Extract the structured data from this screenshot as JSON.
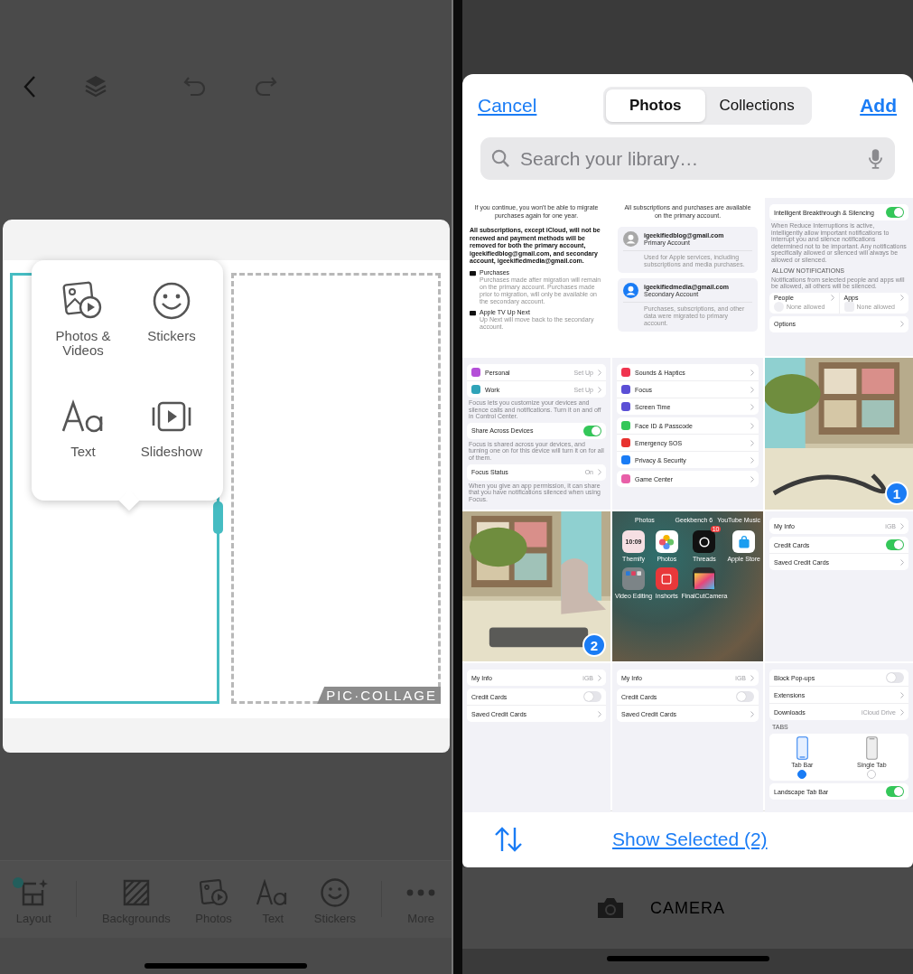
{
  "editor": {
    "popup_menu": {
      "items": [
        {
          "label": "Photos & Videos"
        },
        {
          "label": "Stickers"
        },
        {
          "label": "Text"
        },
        {
          "label": "Slideshow"
        }
      ]
    },
    "canvas": {
      "watermark": "PIC·COLLAGE"
    },
    "bottom_toolbar": {
      "items": [
        {
          "label": "Layout",
          "new_dot": true
        },
        {
          "label": "Backgrounds",
          "new_dot": false
        },
        {
          "label": "Photos",
          "new_dot": false
        },
        {
          "label": "Text",
          "new_dot": false
        },
        {
          "label": "Stickers",
          "new_dot": false
        },
        {
          "label": "More",
          "new_dot": false
        }
      ]
    }
  },
  "picker": {
    "cancel": "Cancel",
    "add": "Add",
    "tabs": [
      {
        "label": "Photos",
        "selected": true
      },
      {
        "label": "Collections",
        "selected": false
      }
    ],
    "search": {
      "placeholder": "Search your library…"
    },
    "grid": {
      "cells": [
        {
          "kind": "document",
          "blocks": [
            {
              "kind": "intro",
              "text": "If you continue, you won't be able to migrate purchases again for one year."
            },
            {
              "kind": "warning",
              "text": "All subscriptions, except iCloud, will not be renewed and payment methods will be removed for both the primary account, igeekifiedblog@gmail.com, and secondary account, igeekifiedmedia@gmail.com."
            },
            {
              "kind": "feature",
              "title": "Purchases",
              "note": "Purchases made after migration will remain on the primary account. Purchases made prior to migration, will only be available on the secondary account."
            },
            {
              "kind": "feature",
              "title": "Apple TV Up Next",
              "note": "Up Next will move back to the secondary account."
            }
          ]
        },
        {
          "kind": "document",
          "blocks": [
            {
              "kind": "intro",
              "text": "All subscriptions and purchases are available on the primary account."
            },
            {
              "kind": "account",
              "email": "igeekifiedblog@gmail.com",
              "role": "Primary Account",
              "note": "Used for Apple services, including subscriptions and media purchases.",
              "color": "#a8a8a8"
            },
            {
              "kind": "account",
              "email": "igeekifiedmedia@gmail.com",
              "role": "Secondary Account",
              "note": "Purchases, subscriptions, and other data were migrated to primary account.",
              "color": "#1a7cf5"
            }
          ]
        },
        {
          "kind": "settings",
          "blocks": [
            {
              "kind": "group",
              "rows": [
                {
                  "kind": "switch",
                  "label": "Intelligent Breakthrough & Silencing",
                  "on": true
                }
              ]
            },
            {
              "kind": "note",
              "text": "When Reduce Interruptions is active, intelligently allow important notifications to interrupt you and silence notifications determined not to be important. Any notifications specifically allowed or silenced will always be allowed or silenced."
            },
            {
              "kind": "section",
              "text": "ALLOW NOTIFICATIONS"
            },
            {
              "kind": "note",
              "text": "Notifications from selected people and apps will be allowed, all others will be silenced."
            },
            {
              "kind": "split",
              "items": [
                {
                  "label": "People",
                  "note": "None allowed"
                },
                {
                  "label": "Apps",
                  "note": "None allowed"
                }
              ]
            },
            {
              "kind": "group",
              "rows": [
                {
                  "kind": "link",
                  "label": "Options"
                }
              ]
            }
          ]
        },
        {
          "kind": "settings",
          "blocks": [
            {
              "kind": "group",
              "rows": [
                {
                  "kind": "link",
                  "label": "Personal",
                  "value": "Set Up",
                  "color": "#b44fd8"
                },
                {
                  "kind": "link",
                  "label": "Work",
                  "value": "Set Up",
                  "color": "#2fa3b8"
                }
              ]
            },
            {
              "kind": "note",
              "text": "Focus lets you customize your devices and silence calls and notifications. Turn it on and off in Control Center."
            },
            {
              "kind": "group",
              "rows": [
                {
                  "kind": "switch",
                  "label": "Share Across Devices",
                  "on": true
                }
              ]
            },
            {
              "kind": "note",
              "text": "Focus is shared across your devices, and turning one on for this device will turn it on for all of them."
            },
            {
              "kind": "group",
              "rows": [
                {
                  "kind": "link",
                  "label": "Focus Status",
                  "value": "On"
                }
              ]
            },
            {
              "kind": "note",
              "text": "When you give an app permission, it can share that you have notifications silenced when using Focus."
            }
          ]
        },
        {
          "kind": "settings",
          "blocks": [
            {
              "kind": "group",
              "rows": [
                {
                  "kind": "link",
                  "label": "Sounds & Haptics",
                  "color": "#f0344f"
                },
                {
                  "kind": "link",
                  "label": "Focus",
                  "color": "#5b4fd6"
                },
                {
                  "kind": "link",
                  "label": "Screen Time",
                  "color": "#5b4fd6"
                }
              ]
            },
            {
              "kind": "group",
              "rows": [
                {
                  "kind": "link",
                  "label": "Face ID & Passcode",
                  "color": "#34c759"
                },
                {
                  "kind": "link",
                  "label": "Emergency SOS",
                  "color": "#e8322f"
                },
                {
                  "kind": "link",
                  "label": "Privacy & Security",
                  "color": "#1a7cf5"
                }
              ]
            },
            {
              "kind": "group",
              "rows": [
                {
                  "kind": "link",
                  "label": "Game Center",
                  "color": "#e85fa8"
                }
              ]
            }
          ]
        },
        {
          "kind": "picture",
          "selection_number": "1"
        },
        {
          "kind": "picture",
          "selection_number": "2"
        },
        {
          "kind": "homescreen",
          "top_labels": [
            "Photos",
            "Geekbench 6",
            "YouTube Music"
          ],
          "apps": [
            {
              "kind": "widget",
              "label": "Themify",
              "color": "#f6dfe3",
              "icon_text": "10:09"
            },
            {
              "kind": "app",
              "label": "Photos",
              "color": "#ffffff"
            },
            {
              "kind": "app",
              "label": "Threads",
              "color": "#111111",
              "badge": "10"
            },
            {
              "kind": "app",
              "label": "Apple Store",
              "color": "#ffffff"
            },
            {
              "kind": "folder",
              "label": "Video Editing",
              "color": "#7c8487"
            },
            {
              "kind": "app",
              "label": "Inshorts",
              "color": "#e8383a"
            },
            {
              "kind": "app",
              "label": "FinalCutCamera",
              "color": "#2b2b2b"
            }
          ]
        },
        {
          "kind": "settings",
          "blocks": [
            {
              "kind": "group",
              "rows": [
                {
                  "kind": "link",
                  "label": "My Info",
                  "value": "iGB"
                }
              ]
            },
            {
              "kind": "group",
              "rows": [
                {
                  "kind": "switch",
                  "label": "Credit Cards",
                  "on": true
                },
                {
                  "kind": "link",
                  "label": "Saved Credit Cards"
                }
              ]
            }
          ]
        },
        {
          "kind": "settings",
          "blocks": [
            {
              "kind": "group",
              "rows": [
                {
                  "kind": "link",
                  "label": "My Info",
                  "value": "iGB"
                }
              ]
            },
            {
              "kind": "group",
              "rows": [
                {
                  "kind": "switch",
                  "label": "Credit Cards",
                  "on": false
                },
                {
                  "kind": "link",
                  "label": "Saved Credit Cards"
                }
              ]
            }
          ]
        },
        {
          "kind": "settings",
          "blocks": [
            {
              "kind": "group",
              "rows": [
                {
                  "kind": "link",
                  "label": "My Info",
                  "value": "iGB"
                }
              ]
            },
            {
              "kind": "group",
              "rows": [
                {
                  "kind": "switch",
                  "label": "Credit Cards",
                  "on": false
                },
                {
                  "kind": "link",
                  "label": "Saved Credit Cards"
                }
              ]
            }
          ]
        },
        {
          "kind": "settings",
          "blocks": [
            {
              "kind": "group",
              "rows": [
                {
                  "kind": "switch",
                  "label": "Block Pop-ups",
                  "on": false
                },
                {
                  "kind": "link",
                  "label": "Extensions"
                },
                {
                  "kind": "link",
                  "label": "Downloads",
                  "value": "iCloud Drive"
                }
              ]
            },
            {
              "kind": "section",
              "text": "TABS"
            },
            {
              "kind": "tab_choice",
              "options": [
                {
                  "label": "Tab Bar",
                  "selected": true
                },
                {
                  "label": "Single Tab",
                  "selected": false
                }
              ]
            },
            {
              "kind": "group",
              "rows": [
                {
                  "kind": "switch",
                  "label": "Landscape Tab Bar",
                  "on": true
                }
              ]
            }
          ]
        }
      ]
    },
    "show_selected": "Show Selected (2)"
  },
  "camera_label": "CAMERA"
}
